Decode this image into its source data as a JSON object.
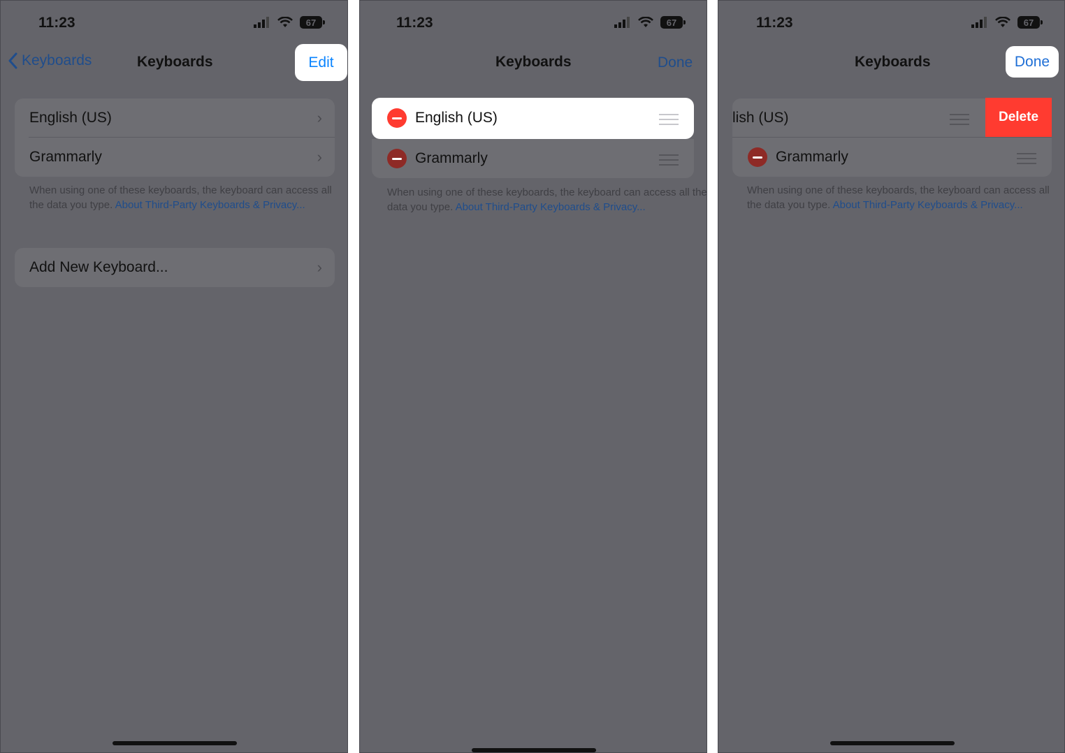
{
  "status": {
    "time": "11:23",
    "battery": "67"
  },
  "panels": [
    {
      "nav": {
        "back_label": "Keyboards",
        "title": "Keyboards",
        "action": "Edit"
      },
      "keyboards": [
        "English (US)",
        "Grammarly"
      ],
      "footnote": {
        "text": "When using one of these keyboards, the keyboard can access all the data you type.",
        "link": "About Third-Party Keyboards & Privacy..."
      },
      "add_keyboard": "Add New Keyboard..."
    },
    {
      "nav": {
        "title": "Keyboards",
        "action": "Done"
      },
      "keyboards": [
        "English (US)",
        "Grammarly"
      ],
      "footnote": {
        "text": "When using one of these keyboards, the keyboard can access all the data you type.",
        "link": "About Third-Party Keyboards & Privacy..."
      }
    },
    {
      "nav": {
        "title": "Keyboards",
        "action": "Done"
      },
      "keyboards": [
        "lish (US)",
        "Grammarly"
      ],
      "delete_label": "Delete",
      "footnote": {
        "text": "When using one of these keyboards, the keyboard can access all the data you type.",
        "link": "About Third-Party Keyboards & Privacy..."
      }
    }
  ],
  "colors": {
    "accent": "#0a84ff",
    "destructive": "#ff3b30",
    "dim_overlay": "#64646a"
  }
}
